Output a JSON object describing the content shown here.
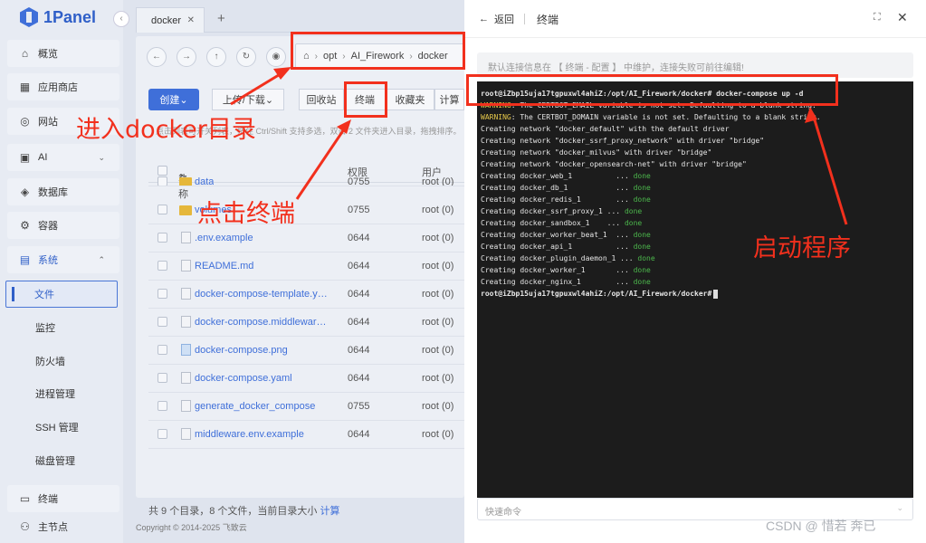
{
  "sidebar": {
    "logo": "1Panel",
    "collapse": "‹",
    "items": [
      {
        "label": "概览",
        "icon": "home-icon"
      },
      {
        "label": "应用商店",
        "icon": "grid-icon"
      },
      {
        "label": "网站",
        "icon": "globe-icon"
      },
      {
        "label": "AI",
        "icon": "ai-chip-icon"
      },
      {
        "label": "数据库",
        "icon": "database-icon"
      },
      {
        "label": "容器",
        "icon": "container-icon"
      },
      {
        "label": "系统",
        "icon": "system-icon"
      }
    ],
    "sub_items": [
      "文件",
      "监控",
      "防火墙",
      "进程管理",
      "SSH 管理",
      "磁盘管理"
    ],
    "bottom": [
      {
        "label": "终端",
        "icon": "terminal-icon"
      },
      {
        "label": "主节点",
        "icon": "user-icon"
      }
    ]
  },
  "main": {
    "tab_label": "docker",
    "path": [
      "opt",
      "AI_Firework",
      "docker"
    ],
    "toolbar": {
      "create": "创建",
      "upload_download": "上传/下载",
      "recycle": "回收站",
      "terminal": "终端",
      "favorites": "收藏夹",
      "calc": "计算"
    },
    "hint": "点击列表可开关列表，按住 Ctrl/Shift 支持多选，双击 2 文件夹进入目录，拖拽排序。",
    "columns": {
      "name": "名称",
      "permission": "权限",
      "user": "用户"
    },
    "rows": [
      {
        "name": "data",
        "perm": "0755",
        "user": "root (0)",
        "type": "folder"
      },
      {
        "name": "volumes",
        "perm": "0755",
        "user": "root (0)",
        "type": "folder"
      },
      {
        "name": ".env.example",
        "perm": "0644",
        "user": "root (0)",
        "type": "file"
      },
      {
        "name": "README.md",
        "perm": "0644",
        "user": "root (0)",
        "type": "file"
      },
      {
        "name": "docker-compose-template.yaml",
        "perm": "0644",
        "user": "root (0)",
        "type": "file"
      },
      {
        "name": "docker-compose.middleware.yaml",
        "perm": "0644",
        "user": "root (0)",
        "type": "file"
      },
      {
        "name": "docker-compose.png",
        "perm": "0644",
        "user": "root (0)",
        "type": "png"
      },
      {
        "name": "docker-compose.yaml",
        "perm": "0644",
        "user": "root (0)",
        "type": "file"
      },
      {
        "name": "generate_docker_compose",
        "perm": "0755",
        "user": "root (0)",
        "type": "file"
      },
      {
        "name": "middleware.env.example",
        "perm": "0644",
        "user": "root (0)",
        "type": "file"
      }
    ],
    "summary": "共 9 个目录，8 个文件，当前目录大小",
    "summary_calc": "计算",
    "copyright": "Copyright © 2014-2025 飞致云"
  },
  "drawer": {
    "back": "返回",
    "title": "终端",
    "info": "默认连接信息在 【 终端 - 配置 】 中维护，连接失败可前往编辑!",
    "terminal_lines": [
      {
        "text": "root@iZbp15uja17tgpuxwl4ahiZ:/opt/AI_Firework/docker# docker-compose up -d",
        "kind": "prompt"
      },
      {
        "prefix": "WARNING",
        "text": ": The CERTBOT_EMAIL variable is not set. Defaulting to a blank string.",
        "kind": "warn"
      },
      {
        "prefix": "WARNING",
        "text": ": The CERTBOT_DOMAIN variable is not set. Defaulting to a blank string.",
        "kind": "warn"
      },
      {
        "text": "Creating network \"docker_default\" with the default driver",
        "kind": "plain"
      },
      {
        "text": "Creating network \"docker_ssrf_proxy_network\" with driver \"bridge\"",
        "kind": "plain"
      },
      {
        "text": "Creating network \"docker_milvus\" with driver \"bridge\"",
        "kind": "plain"
      },
      {
        "text": "Creating network \"docker_opensearch-net\" with driver \"bridge\"",
        "kind": "plain"
      },
      {
        "text": "Creating docker_web_1          ... ",
        "status": "done",
        "kind": "done"
      },
      {
        "text": "Creating docker_db_1           ... ",
        "status": "done",
        "kind": "done"
      },
      {
        "text": "Creating docker_redis_1        ... ",
        "status": "done",
        "kind": "done"
      },
      {
        "text": "Creating docker_ssrf_proxy_1 ... ",
        "status": "done",
        "kind": "done"
      },
      {
        "text": "Creating docker_sandbox_1    ... ",
        "status": "done",
        "kind": "done"
      },
      {
        "text": "Creating docker_worker_beat_1  ... ",
        "status": "done",
        "kind": "done"
      },
      {
        "text": "Creating docker_api_1          ... ",
        "status": "done",
        "kind": "done"
      },
      {
        "text": "Creating docker_plugin_daemon_1 ... ",
        "status": "done",
        "kind": "done"
      },
      {
        "text": "Creating docker_worker_1       ... ",
        "status": "done",
        "kind": "done"
      },
      {
        "text": "Creating docker_nginx_1        ... ",
        "status": "done",
        "kind": "done"
      },
      {
        "text": "root@iZbp15uja17tgpuxwl4ahiZ:/opt/AI_Firework/docker#",
        "kind": "prompt-cursor"
      }
    ],
    "quick_placeholder": "快速命令",
    "watermark": "CSDN @ 惜若 奔已"
  },
  "annotations": {
    "enter_dir": "进入docker目录",
    "click_terminal": "点击终端",
    "start_program": "启动程序",
    "color": "#f2301d"
  }
}
